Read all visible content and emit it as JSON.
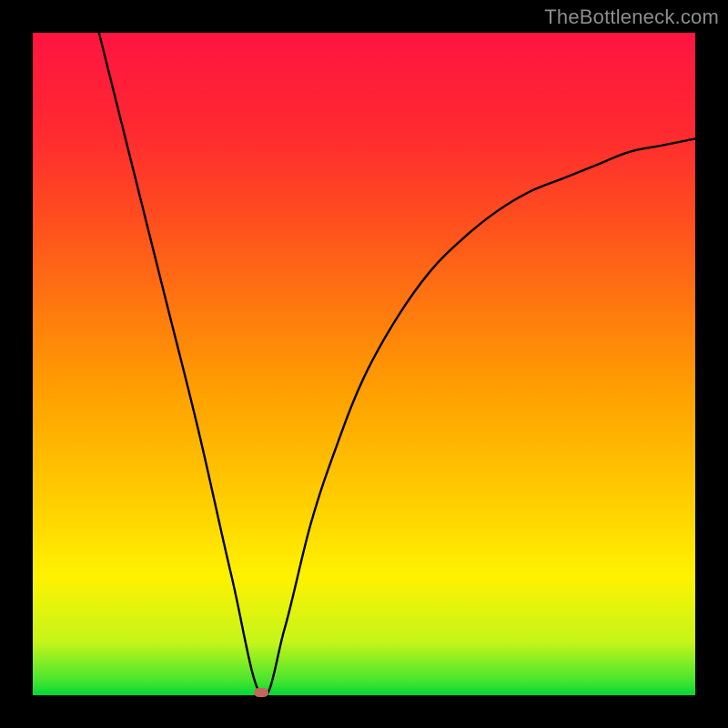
{
  "watermark": "TheBottleneck.com",
  "colors": {
    "frame": "#000000",
    "gradient_top": "#ff1440",
    "gradient_mid": "#ffcc00",
    "gradient_bottom": "#00d936",
    "curve": "#000000",
    "marker": "#c1675f"
  },
  "chart_data": {
    "type": "line",
    "title": "",
    "xlabel": "",
    "ylabel": "",
    "xlim": [
      0,
      100
    ],
    "ylim": [
      0,
      100
    ],
    "grid": false,
    "legend": false,
    "minimum": {
      "x": 34.5,
      "y": 0
    },
    "series": [
      {
        "name": "bottleneck-curve",
        "x": [
          10,
          15,
          20,
          25,
          30,
          34.5,
          38,
          42,
          46,
          50,
          55,
          60,
          65,
          70,
          75,
          80,
          85,
          90,
          95,
          100
        ],
        "y": [
          100,
          80,
          60,
          40,
          18,
          0,
          10,
          26,
          38,
          48,
          57,
          64,
          69,
          73,
          76,
          78,
          80,
          82,
          83,
          84
        ]
      }
    ],
    "annotations": [
      {
        "text": "TheBottleneck.com",
        "position": "top-right"
      }
    ]
  }
}
